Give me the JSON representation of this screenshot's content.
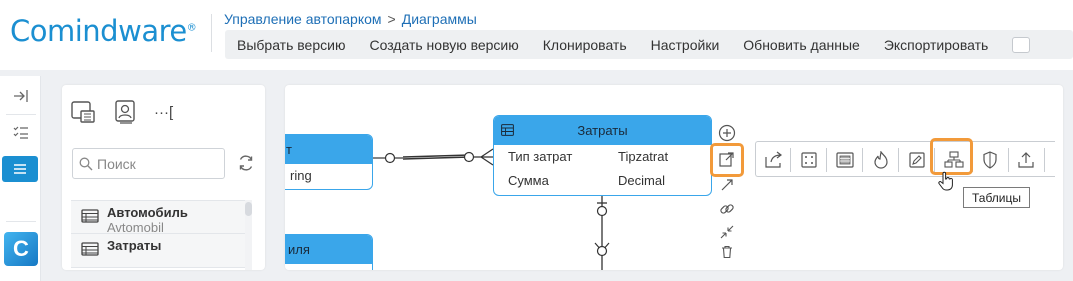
{
  "brand": {
    "logo_text_1": "Co",
    "logo_text_2": "mind",
    "logo_text_3": "ware",
    "logo_reg": "®"
  },
  "breadcrumb": {
    "parent": "Управление автопарком",
    "separator": ">",
    "current": "Диаграммы"
  },
  "toolbar": {
    "items": [
      "Выбрать версию",
      "Создать новую версию",
      "Клонировать",
      "Настройки",
      "Обновить данные",
      "Экспортировать"
    ]
  },
  "rail": {
    "app_tile_letter": "C"
  },
  "side_panel": {
    "search_placeholder": "Поиск",
    "items": [
      {
        "title": "Автомобиль",
        "subtitle": "Avtomobil"
      },
      {
        "title": "Затраты",
        "subtitle": ""
      }
    ],
    "bracket_icon_text": "···["
  },
  "canvas": {
    "left_entity": {
      "header_fragment": "т",
      "row_fragment": "ring"
    },
    "main_entity": {
      "title": "Затраты",
      "rows": [
        {
          "name": "Тип затрат",
          "type": "Tipzatrat"
        },
        {
          "name": "Сумма",
          "type": "Decimal"
        }
      ]
    },
    "bottom_entity": {
      "header_fragment": "иля"
    }
  },
  "tooltip": "Таблицы",
  "colors": {
    "accent": "#1b8fd1",
    "entity_blue": "#3aa6ea",
    "highlight": "#f29a3a"
  }
}
